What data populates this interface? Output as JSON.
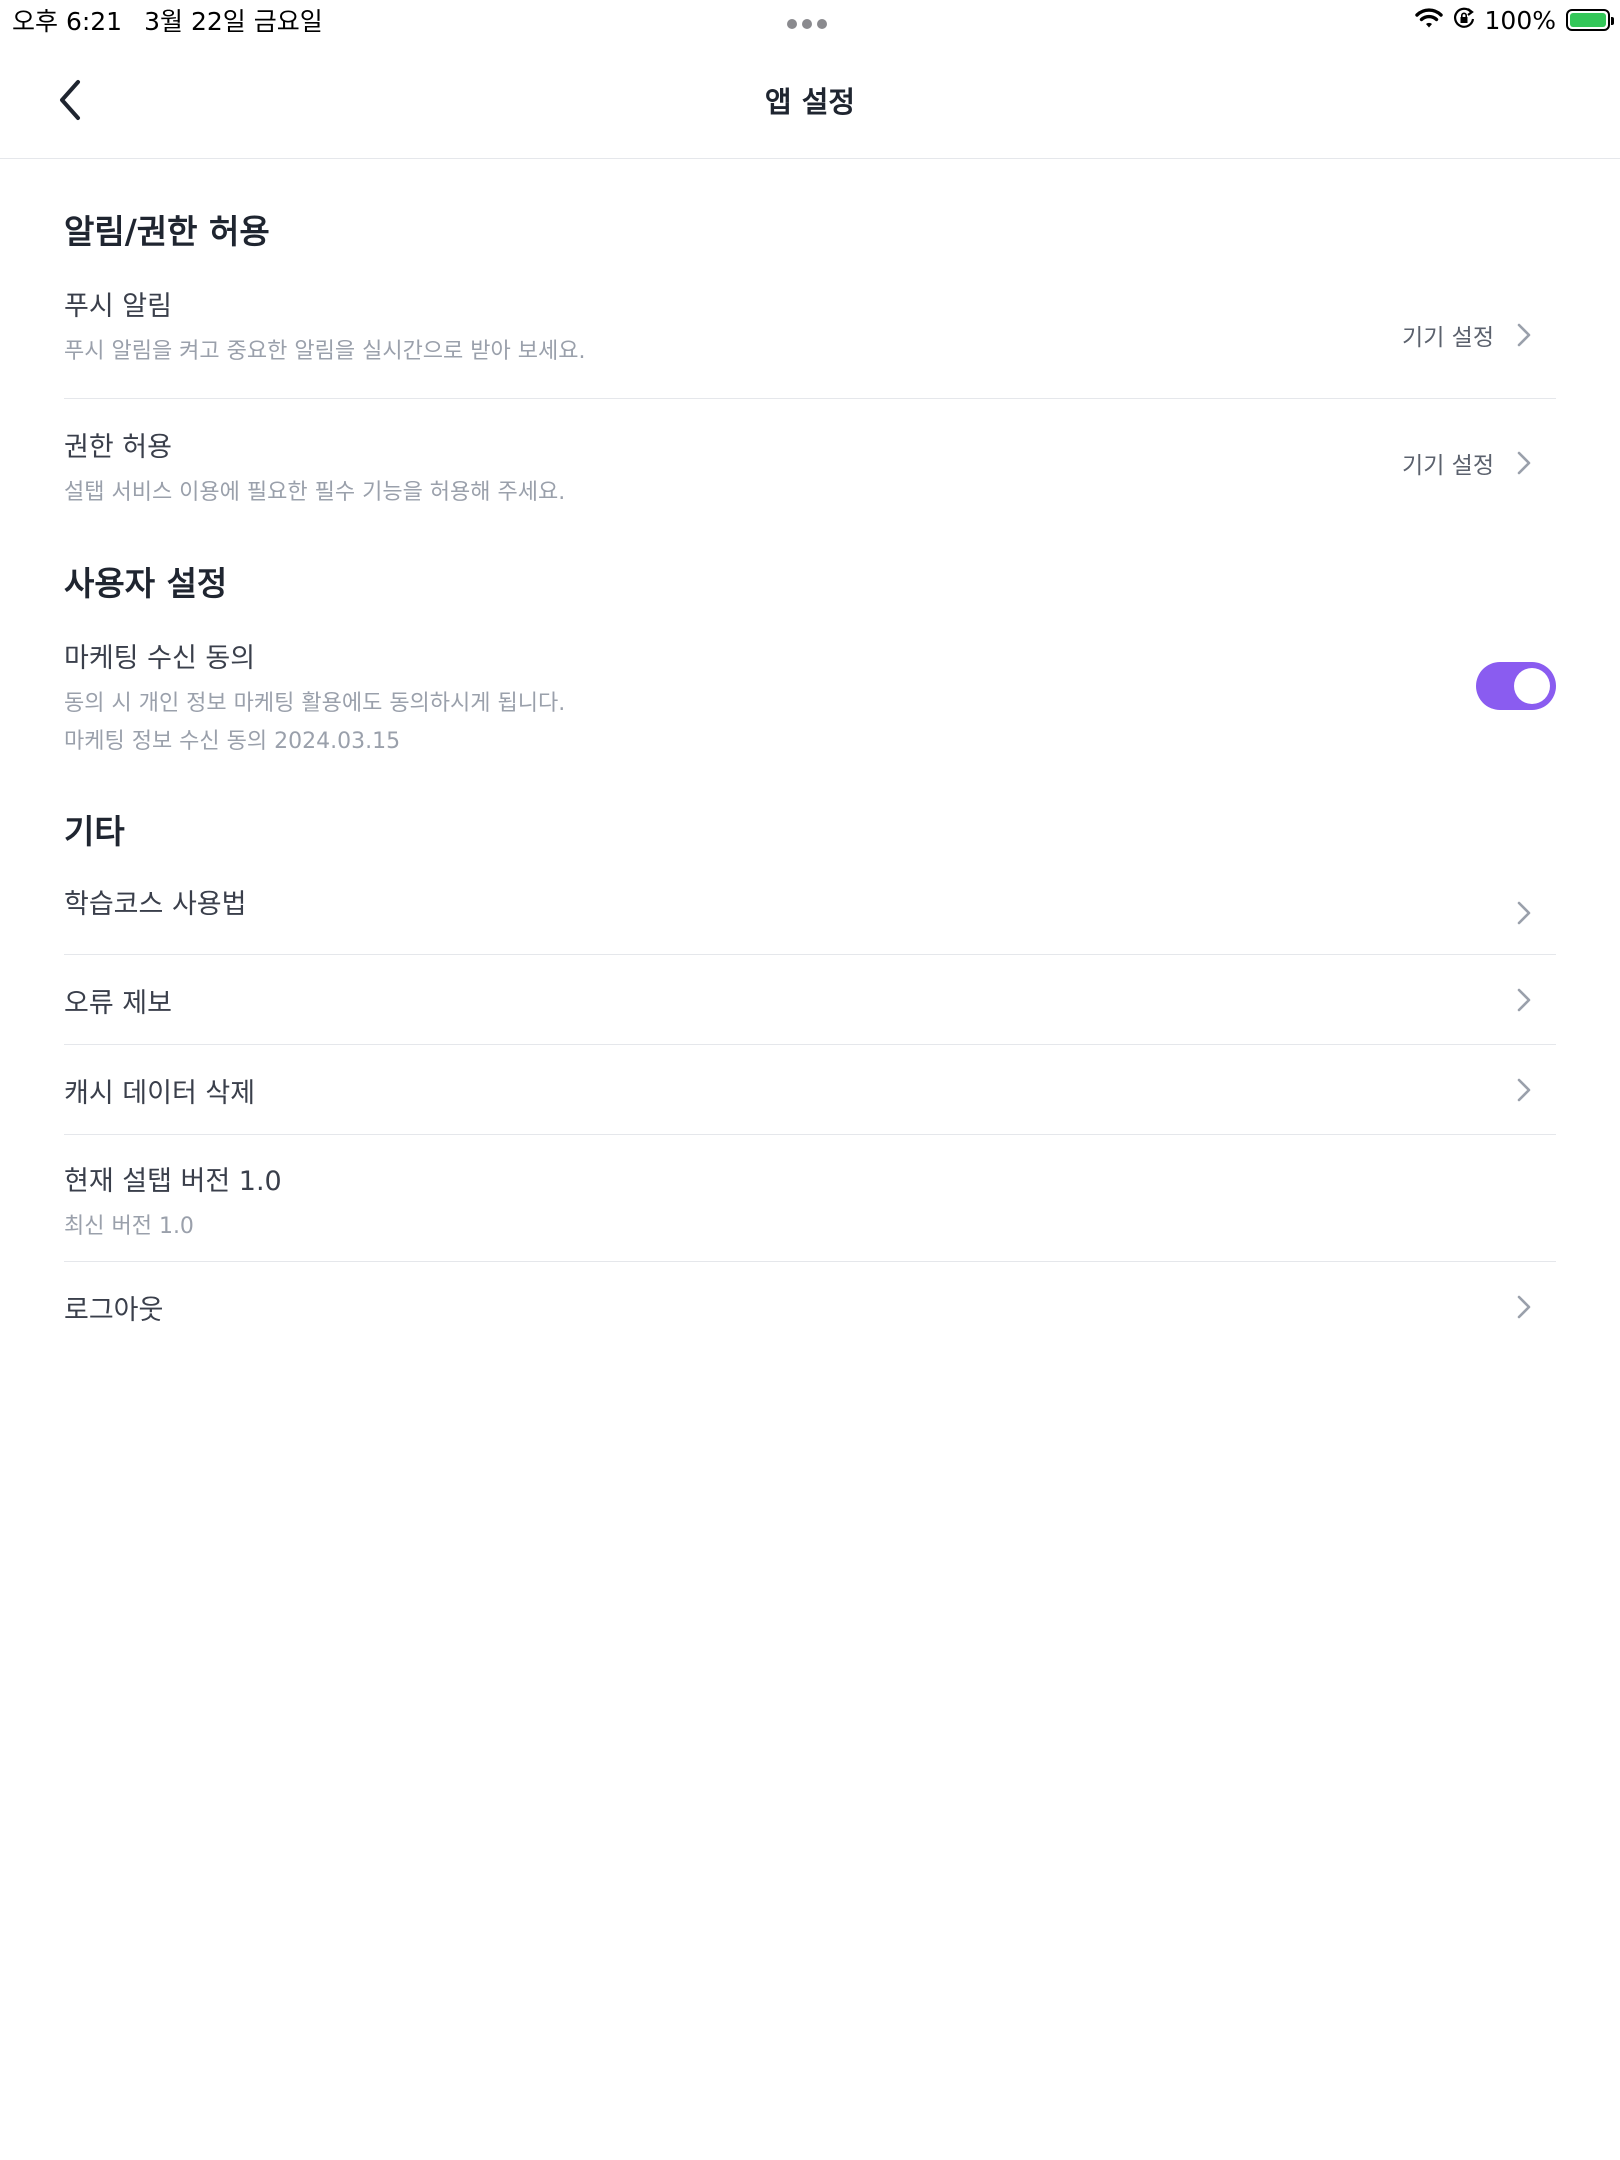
{
  "status_bar": {
    "time": "오후 6:21",
    "date": "3월 22일 금요일",
    "battery": "100%",
    "battery_color": "#34c759"
  },
  "nav": {
    "title": "앱 설정",
    "back_icon": "chevron-left-icon"
  },
  "sections": {
    "notifications": {
      "title": "알림/권한 허용",
      "push": {
        "title": "푸시 알림",
        "desc": "푸시 알림을 켜고 중요한 알림을 실시간으로 받아 보세요.",
        "action": "기기 설정"
      },
      "permission": {
        "title": "권한 허용",
        "desc": "설탭 서비스 이용에 필요한 필수 기능을 허용해 주세요.",
        "action": "기기 설정"
      }
    },
    "user": {
      "title": "사용자 설정",
      "marketing": {
        "title": "마케팅 수신 동의",
        "desc1": "동의 시 개인 정보 마케팅 활용에도 동의하시게 됩니다.",
        "desc2": "마케팅 정보 수신 동의 2024.03.15",
        "enabled": true,
        "toggle_color": "#8a5cf0"
      }
    },
    "etc": {
      "title": "기타",
      "guide": "학습코스 사용법",
      "report": "오류 제보",
      "cache": "캐시 데이터 삭제",
      "version": {
        "title": "현재 설탭 버전 1.0",
        "latest": "최신 버전 1.0"
      },
      "logout": "로그아웃"
    }
  }
}
